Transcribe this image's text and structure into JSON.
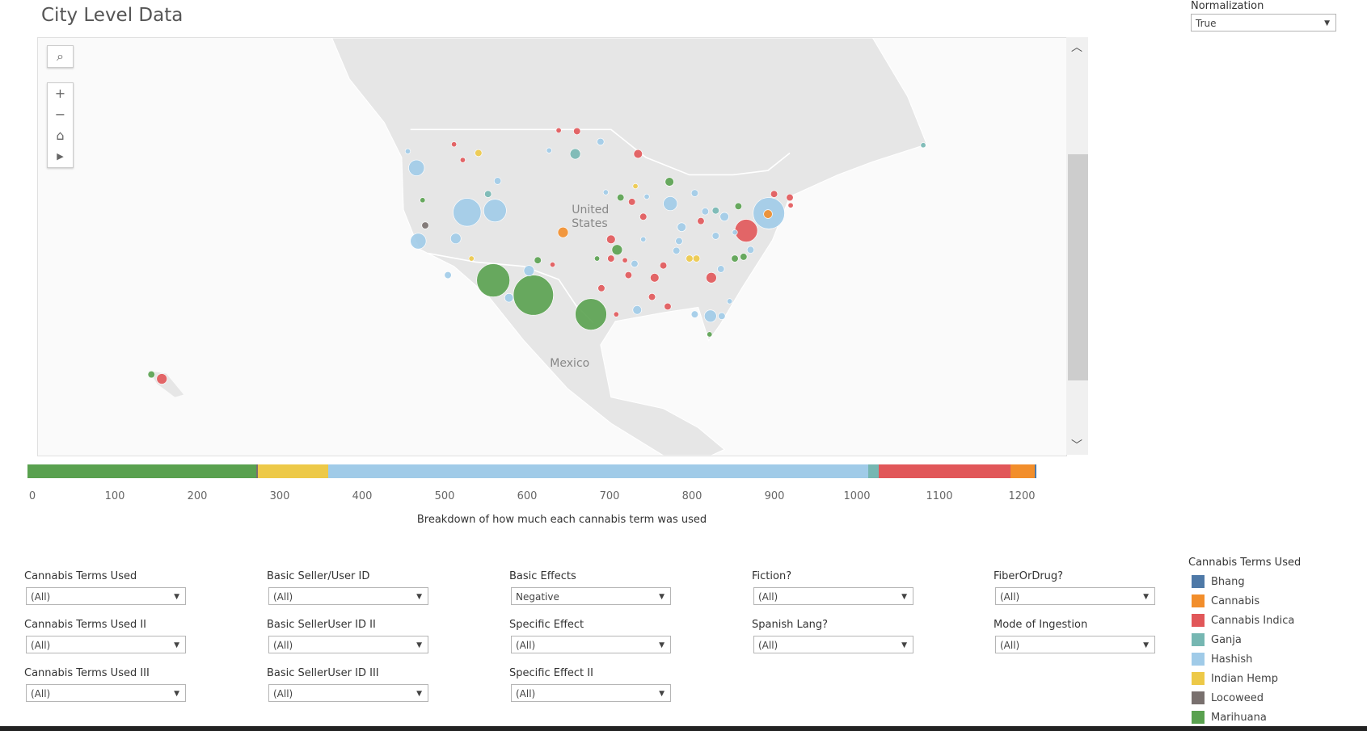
{
  "title": "City Level Data",
  "normalization": {
    "label": "Normalization",
    "value": "True"
  },
  "map": {
    "labels": [
      "United States",
      "Mexico"
    ],
    "united_states_line1": "United",
    "united_states_line2": "States",
    "mexico": "Mexico"
  },
  "colors": {
    "Bhang": "#4e79a7",
    "Cannabis": "#f28e2b",
    "Cannabis Indica": "#e15759",
    "Ganja": "#76b7b2",
    "Hashish": "#a0cbe8",
    "Indian Hemp": "#edc948",
    "Locoweed": "#79706e",
    "Marihuana": "#59a14f"
  },
  "chart_data": {
    "type": "bar",
    "stacked": true,
    "orientation": "horizontal",
    "xlabel": "Breakdown of how much each cannabis term was used",
    "xlim": [
      0,
      1250
    ],
    "ticks": [
      0,
      100,
      200,
      300,
      400,
      500,
      600,
      700,
      800,
      900,
      1000,
      1100,
      1200
    ],
    "series": [
      {
        "name": "Marihuana",
        "value": 277
      },
      {
        "name": "Locoweed",
        "value": 2
      },
      {
        "name": "Indian Hemp",
        "value": 86
      },
      {
        "name": "Hashish",
        "value": 655
      },
      {
        "name": "Ganja",
        "value": 12
      },
      {
        "name": "Cannabis Indica",
        "value": 160
      },
      {
        "name": "Cannabis",
        "value": 30
      },
      {
        "name": "Bhang",
        "value": 2
      }
    ]
  },
  "filters": [
    {
      "label": "Cannabis Terms Used",
      "value": "(All)"
    },
    {
      "label": "Basic Seller/User ID",
      "value": "(All)"
    },
    {
      "label": "Basic Effects",
      "value": "Negative"
    },
    {
      "label": "Fiction?",
      "value": "(All)"
    },
    {
      "label": "FiberOrDrug?",
      "value": "(All)"
    },
    {
      "label": "Cannabis Terms Used II",
      "value": "(All)"
    },
    {
      "label": "Basic SellerUser ID II",
      "value": "(All)"
    },
    {
      "label": "Specific Effect",
      "value": "(All)"
    },
    {
      "label": "Spanish Lang?",
      "value": "(All)"
    },
    {
      "label": "Mode of Ingestion",
      "value": "(All)"
    },
    {
      "label": "Cannabis Terms Used III",
      "value": "(All)"
    },
    {
      "label": "Basic SellerUser ID III",
      "value": "(All)"
    },
    {
      "label": "Specific Effect II",
      "value": "(All)"
    }
  ],
  "legend": {
    "title": "Cannabis Terms Used",
    "items": [
      "Bhang",
      "Cannabis",
      "Cannabis Indica",
      "Ganja",
      "Hashish",
      "Indian Hemp",
      "Locoweed",
      "Marihuana"
    ]
  }
}
